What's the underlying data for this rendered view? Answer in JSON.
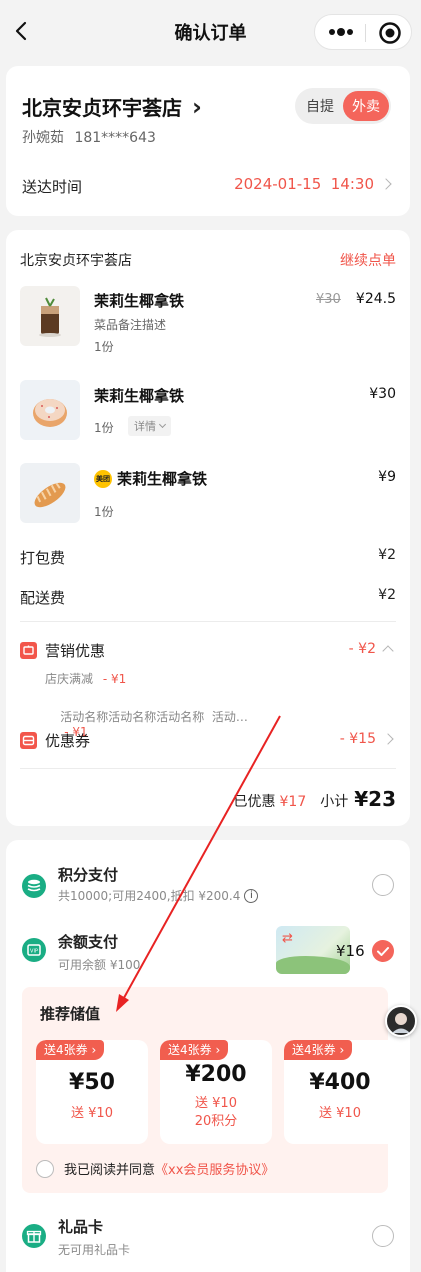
{
  "nav": {
    "title": "确认订单",
    "back_icon": "back-icon",
    "more_icon": "more-icon",
    "capsule_icon": "target-icon"
  },
  "store_card": {
    "store_name": "北京安贞环宇荟店",
    "chevron": "›",
    "user_name": "孙婉茹",
    "phone": "181****643",
    "pickup_label": "自提",
    "delivery_label": "外卖",
    "delivery_time_label": "送达时间",
    "delivery_time_value": "2024-01-15  14:30"
  },
  "order": {
    "store_name": "北京安贞环宇荟店",
    "continue_label": "继续点单",
    "items": [
      {
        "name": "茉莉生椰拿铁",
        "note": "菜品备注描述",
        "qty": "1份",
        "original_price": "¥30",
        "price": "¥24.5"
      },
      {
        "name": "茉莉生椰拿铁",
        "qty": "1份",
        "detail_label": "详情",
        "price": "¥30"
      },
      {
        "name": "茉莉生椰拿铁",
        "badge": "美团",
        "qty": "1份",
        "price": "¥9"
      }
    ],
    "packing_fee_label": "打包费",
    "packing_fee": "¥2",
    "delivery_fee_label": "配送费",
    "delivery_fee": "¥2",
    "promo": {
      "title": "营销优惠",
      "amount": "- ¥2",
      "lines": [
        {
          "text": "店庆满减",
          "amount": "- ¥1"
        },
        {
          "text": "活动名称活动名称活动名称  活动…",
          "amount": "- ¥1"
        }
      ]
    },
    "coupon": {
      "title": "优惠券",
      "amount": "- ¥15"
    },
    "summary": {
      "discount_label": "已优惠",
      "discount_value": "¥17",
      "subtotal_label": "小计",
      "subtotal_value": "¥23"
    }
  },
  "payment": {
    "points": {
      "title": "积分支付",
      "desc": "共10000;可用2400,抵扣 ¥200.4"
    },
    "balance": {
      "title": "余额支付",
      "desc": "可用余额 ¥100",
      "amount": "¥16"
    },
    "recharge": {
      "title": "推荐储值",
      "options": [
        {
          "tag": "送4张券 ›",
          "amount": "¥50",
          "gift": "送 ¥10"
        },
        {
          "tag": "送4张券 ›",
          "amount": "¥200",
          "gift": "送 ¥10",
          "gift2": "20积分"
        },
        {
          "tag": "送4张券 ›",
          "amount": "¥400",
          "gift": "送 ¥10"
        }
      ],
      "agree_text": "我已阅读并同意",
      "agreement_link": "《xx会员服务协议》"
    },
    "gift_card": {
      "title": "礼品卡",
      "desc": "无可用礼品卡"
    }
  },
  "colors": {
    "accent": "#f0554a",
    "pay_green": "#1aad84",
    "tint": "#fff2ef"
  }
}
